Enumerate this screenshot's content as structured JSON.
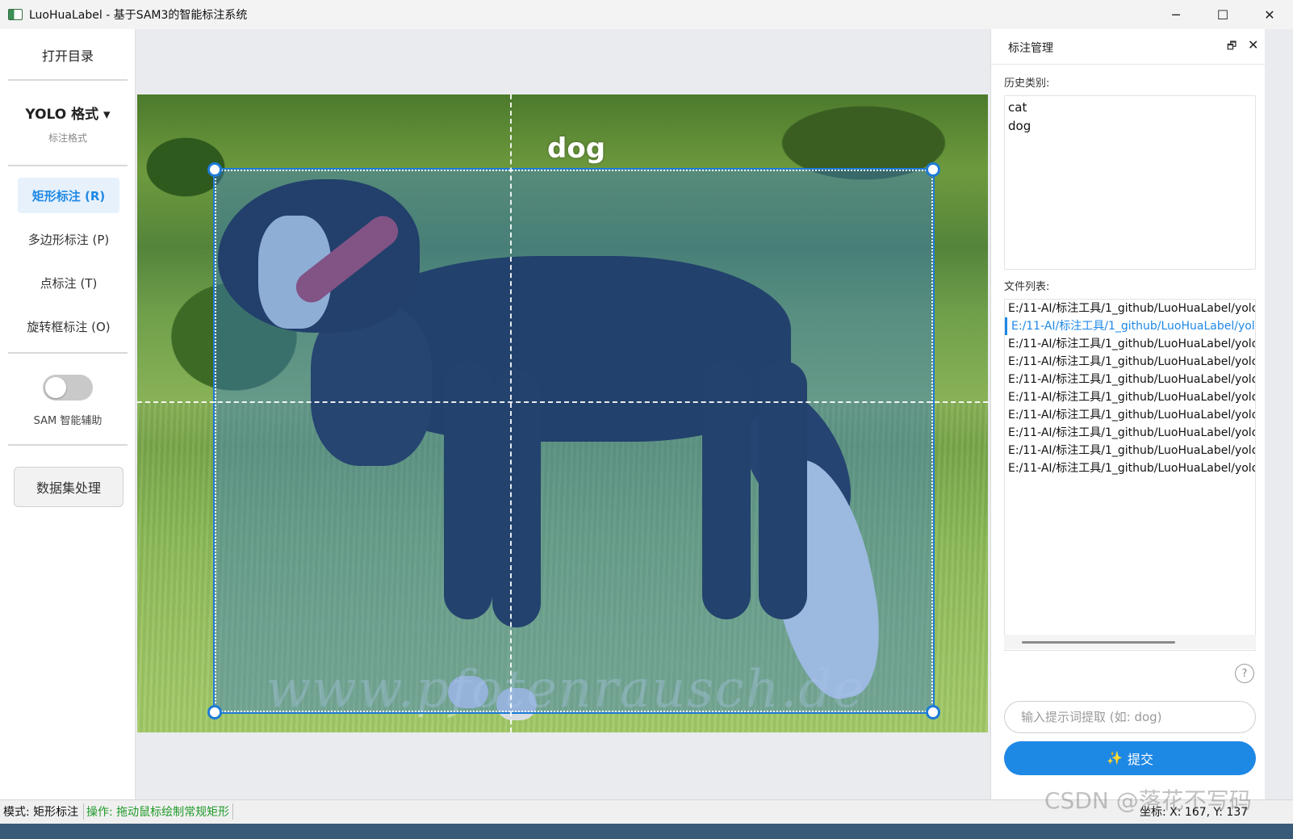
{
  "window": {
    "title": "LuoHuaLabel - 基于SAM3的智能标注系统",
    "controls": {
      "minimize": "─",
      "maximize": "☐",
      "close": "✕"
    }
  },
  "left_toolbar": {
    "open_dir_label": "打开目录",
    "format_label": "YOLO 格式 ▾",
    "format_caption": "标注格式",
    "modes": [
      {
        "label": "矩形标注 (R)",
        "active": true
      },
      {
        "label": "多边形标注 (P)",
        "active": false
      },
      {
        "label": "点标注 (T)",
        "active": false
      },
      {
        "label": "旋转框标注 (O)",
        "active": false
      }
    ],
    "sam_toggle_caption": "SAM 智能辅助",
    "sam_enabled": false,
    "dataset_button_label": "数据集处理"
  },
  "canvas": {
    "annotation_label": "dog",
    "photo_watermark": "www.pfotenrausch.de"
  },
  "right_panel": {
    "title": "标注管理",
    "float_icon": "🗗",
    "close_icon": "✕",
    "history_label": "历史类别:",
    "history_classes": [
      "cat",
      "dog"
    ],
    "file_list_label": "文件列表:",
    "files": [
      "E:/11-AI/标注工具/1_github/LuoHuaLabel/yolo",
      "E:/11-AI/标注工具/1_github/LuoHuaLabel/yolo",
      "E:/11-AI/标注工具/1_github/LuoHuaLabel/yolo",
      "E:/11-AI/标注工具/1_github/LuoHuaLabel/yolo",
      "E:/11-AI/标注工具/1_github/LuoHuaLabel/yolo",
      "E:/11-AI/标注工具/1_github/LuoHuaLabel/yolo",
      "E:/11-AI/标注工具/1_github/LuoHuaLabel/yolo",
      "E:/11-AI/标注工具/1_github/LuoHuaLabel/yolo",
      "E:/11-AI/标注工具/1_github/LuoHuaLabel/yolo",
      "E:/11-AI/标注工具/1_github/LuoHuaLabel/yolo"
    ],
    "selected_file_index": 1,
    "help_label": "?",
    "prompt_placeholder": "输入提示词提取 (如: dog)",
    "submit_icon": "✨",
    "submit_label": "提交"
  },
  "status_bar": {
    "mode_text": "模式: 矩形标注",
    "hint_text": "操作: 拖动鼠标绘制常规矩形",
    "coord_text": "坐标: X: 167, Y: 137"
  },
  "overlay_watermark": "CSDN @落花不写码",
  "colors": {
    "accent": "#1e88e5",
    "bbox_fill": "#3778cd",
    "hint_green": "#1f9a2a"
  }
}
